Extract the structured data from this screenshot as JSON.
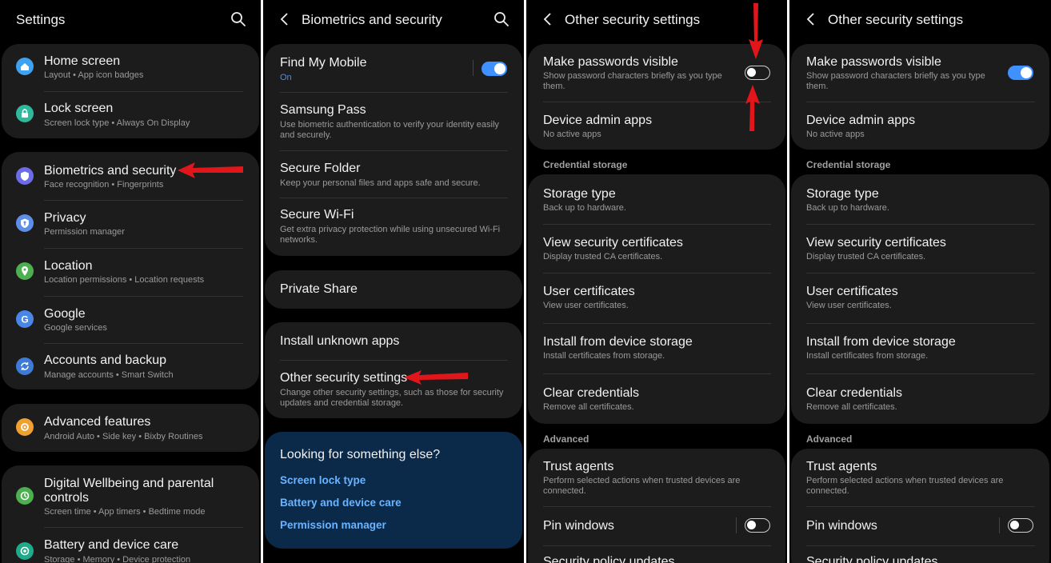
{
  "panel1": {
    "title": "Settings",
    "items": [
      {
        "title": "Home screen",
        "subtitle": "Layout  •  App icon badges",
        "icon": "home-icon",
        "color": "#3fa2f0"
      },
      {
        "title": "Lock screen",
        "subtitle": "Screen lock type  •  Always On Display",
        "icon": "lock-icon",
        "color": "#2fb99a"
      },
      {
        "title": "Biometrics and security",
        "subtitle": "Face recognition  •  Fingerprints",
        "icon": "shield-icon",
        "color": "#6c6ce8"
      },
      {
        "title": "Privacy",
        "subtitle": "Permission manager",
        "icon": "privacy-icon",
        "color": "#5e8ee8"
      },
      {
        "title": "Location",
        "subtitle": "Location permissions  •  Location requests",
        "icon": "location-icon",
        "color": "#4cb050"
      },
      {
        "title": "Google",
        "subtitle": "Google services",
        "icon": "google-icon",
        "color": "#4a86e8"
      },
      {
        "title": "Accounts and backup",
        "subtitle": "Manage accounts  •  Smart Switch",
        "icon": "sync-icon",
        "color": "#3e7bd6"
      },
      {
        "title": "Advanced features",
        "subtitle": "Android Auto  •  Side key  •  Bixby Routines",
        "icon": "gear-plus-icon",
        "color": "#f0a030"
      },
      {
        "title": "Digital Wellbeing and parental",
        "title2": "controls",
        "subtitle": "Screen time  •  App timers  •  Bedtime mode",
        "icon": "wellbeing-icon",
        "color": "#4cb050"
      },
      {
        "title": "Battery and device care",
        "subtitle": "Storage  •  Memory  •  Device protection",
        "icon": "device-care-icon",
        "color": "#1faa8a"
      }
    ]
  },
  "panel2": {
    "title": "Biometrics and security",
    "items": [
      {
        "title": "Find My Mobile",
        "subtitle": "On"
      },
      {
        "title": "Samsung Pass",
        "subtitle": "Use biometric authentication to verify your identity easily and securely."
      },
      {
        "title": "Secure Folder",
        "subtitle": "Keep your personal files and apps safe and secure."
      },
      {
        "title": "Secure Wi-Fi",
        "subtitle": "Get extra privacy protection while using unsecured Wi-Fi networks."
      },
      {
        "title": "Private Share",
        "subtitle": ""
      },
      {
        "title": "Install unknown apps",
        "subtitle": ""
      },
      {
        "title": "Other security settings",
        "subtitle": "Change other security settings, such as those for security updates and credential storage."
      }
    ],
    "suggest": {
      "heading": "Looking for something else?",
      "links": [
        "Screen lock type",
        "Battery and device care",
        "Permission manager"
      ]
    }
  },
  "security": {
    "title": "Other security settings",
    "make_passwords": {
      "title": "Make passwords visible",
      "subtitle": "Show password characters briefly as you type them."
    },
    "device_admin": {
      "title": "Device admin apps",
      "subtitle": "No active apps"
    },
    "credential_label": "Credential storage",
    "credential_items": [
      {
        "title": "Storage type",
        "subtitle": "Back up to hardware."
      },
      {
        "title": "View security certificates",
        "subtitle": "Display trusted CA certificates."
      },
      {
        "title": "User certificates",
        "subtitle": "View user certificates."
      },
      {
        "title": "Install from device storage",
        "subtitle": "Install certificates from storage."
      },
      {
        "title": "Clear credentials",
        "subtitle": "Remove all certificates."
      }
    ],
    "advanced_label": "Advanced",
    "trust_agents": {
      "title": "Trust agents",
      "subtitle": "Perform selected actions when trusted devices are connected."
    },
    "pin_windows": {
      "title": "Pin windows"
    },
    "security_policy": {
      "title": "Security policy updates"
    }
  },
  "colors": {
    "accent": "#3e91ff",
    "arrow": "#e0161b",
    "card": "#1c1c1c",
    "background": "#000000"
  }
}
